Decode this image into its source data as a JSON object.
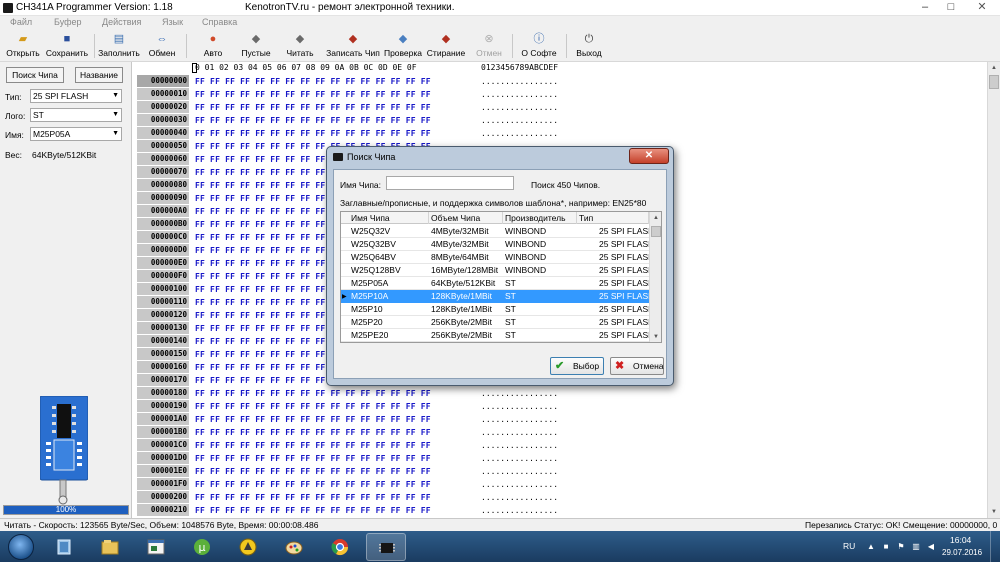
{
  "window": {
    "title": "CH341A Programmer Version: 1.18",
    "center_title": "KenotronTV.ru - ремонт электронной техники."
  },
  "menu": [
    "Файл",
    "Буфер",
    "Действия",
    "Язык",
    "Справка"
  ],
  "toolbar": [
    {
      "label": "Открыть",
      "icon": "folder-open-icon",
      "enabled": true
    },
    {
      "label": "Сохранить",
      "icon": "floppy-disk-icon",
      "enabled": true
    },
    {
      "label": "Заполнить",
      "icon": "fill-icon",
      "enabled": true
    },
    {
      "label": "Обмен",
      "icon": "swap-icon",
      "enabled": true
    },
    {
      "label": "Авто",
      "icon": "auto-icon",
      "enabled": true
    },
    {
      "label": "Пустые",
      "icon": "blank-check-icon",
      "enabled": true
    },
    {
      "label": "Читать",
      "icon": "read-icon",
      "enabled": true
    },
    {
      "label": "Записать Чип",
      "icon": "write-chip-icon",
      "enabled": true
    },
    {
      "label": "Проверка",
      "icon": "verify-icon",
      "enabled": true
    },
    {
      "label": "Стирание",
      "icon": "erase-icon",
      "enabled": true
    },
    {
      "label": "Отмен",
      "icon": "cancel-circle-icon",
      "enabled": false
    },
    {
      "label": "О Софте",
      "icon": "info-icon",
      "enabled": true
    },
    {
      "label": "Выход",
      "icon": "exit-icon",
      "enabled": true
    }
  ],
  "left_panel": {
    "search_chip_button": "Поиск Чипа",
    "name_button": "Название",
    "type_label": "Тип:",
    "type_value": "25 SPI FLASH",
    "logo_label": "Лого:",
    "logo_value": "ST",
    "name_label": "Имя:",
    "name_value": "M25P05A",
    "size_label": "Вес:",
    "size_value": "64KByte/512KBit",
    "progress_percent": 100,
    "progress_text": "100%"
  },
  "hex_view": {
    "header_bytes": "0 01 02 03 04 05 06 07 08 09 0A 0B 0C 0D 0E 0F",
    "header_ascii": "0123456789ABCDEF",
    "row_bytes": "FF FF FF FF FF FF FF FF FF FF FF FF FF FF FF FF",
    "row_ascii": "................",
    "addresses": [
      "00000000",
      "00000010",
      "00000020",
      "00000030",
      "00000040",
      "00000050",
      "00000060",
      "00000070",
      "00000080",
      "00000090",
      "000000A0",
      "000000B0",
      "000000C0",
      "000000D0",
      "000000E0",
      "000000F0",
      "00000100",
      "00000110",
      "00000120",
      "00000130",
      "00000140",
      "00000150",
      "00000160",
      "00000170",
      "00000180",
      "00000190",
      "000001A0",
      "000001B0",
      "000001C0",
      "000001D0",
      "000001E0",
      "000001F0",
      "00000200",
      "00000210"
    ]
  },
  "status_bar": {
    "left": "Читать - Скорость: 123565 Byte/Sec, Объем: 1048576 Byte, Время: 00:00:08.486",
    "right": "Перезапись   Статус: OK!   Смещение: 00000000, 0"
  },
  "dialog": {
    "title": "Поиск Чипа",
    "close_label": "✕",
    "name_label": "Имя Чипа:",
    "search_value": "",
    "count_text": "Поиск 450 Чипов.",
    "hint": "Заглавные/прописные, и поддержка символов шаблона*, например: EN25*80",
    "columns": [
      "Имя Чипа",
      "Объем Чипа",
      "Производитель",
      "Тип"
    ],
    "rows": [
      {
        "name": "W25Q32V",
        "size": "4MByte/32MBit",
        "maker": "WINBOND",
        "type": "25 SPI FLASH",
        "selected": false
      },
      {
        "name": "W25Q32BV",
        "size": "4MByte/32MBit",
        "maker": "WINBOND",
        "type": "25 SPI FLASH",
        "selected": false
      },
      {
        "name": "W25Q64BV",
        "size": "8MByte/64MBit",
        "maker": "WINBOND",
        "type": "25 SPI FLASH",
        "selected": false
      },
      {
        "name": "W25Q128BV",
        "size": "16MByte/128MBit",
        "maker": "WINBOND",
        "type": "25 SPI FLASH",
        "selected": false
      },
      {
        "name": "M25P05A",
        "size": "64KByte/512KBit",
        "maker": "ST",
        "type": "25 SPI FLASH",
        "selected": false
      },
      {
        "name": "M25P10A",
        "size": "128KByte/1MBit",
        "maker": "ST",
        "type": "25 SPI FLASH",
        "selected": true
      },
      {
        "name": "M25P10",
        "size": "128KByte/1MBit",
        "maker": "ST",
        "type": "25 SPI FLASH",
        "selected": false
      },
      {
        "name": "M25P20",
        "size": "256KByte/2MBit",
        "maker": "ST",
        "type": "25 SPI FLASH",
        "selected": false
      },
      {
        "name": "M25PE20",
        "size": "256KByte/2MBit",
        "maker": "ST",
        "type": "25 SPI FLASH",
        "selected": false
      }
    ],
    "ok_label": "Выбор",
    "cancel_label": "Отмена"
  },
  "taskbar": {
    "apps": [
      "windows-explorer-icon",
      "file-manager-icon",
      "window-app-icon",
      "utorrent-icon",
      "norton-commander-icon",
      "paint-icon",
      "chrome-icon",
      "ch341a-programmer-icon"
    ],
    "language": "RU",
    "time": "16:04",
    "date": "29.07.2016"
  },
  "colors": {
    "hex_bytes": "#1818c8",
    "selection": "#3399ff",
    "taskbar": "#1a3b60",
    "progress": "#1e5fbf"
  }
}
